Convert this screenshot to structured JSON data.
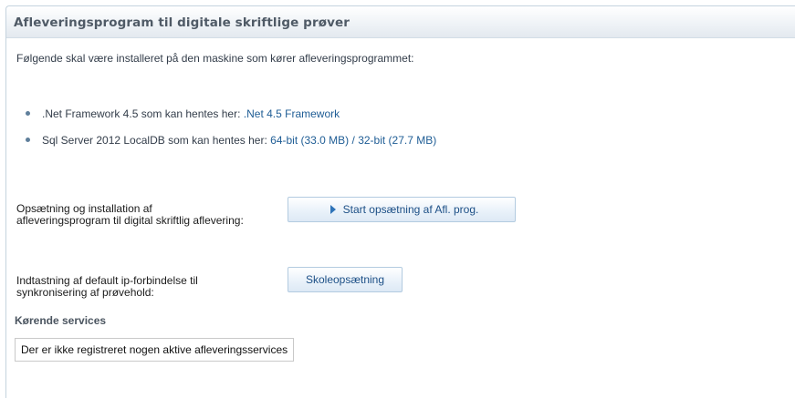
{
  "panel": {
    "title": "Afleveringsprogram til digitale skriftlige prøver"
  },
  "requirements": {
    "intro": "Følgende skal være installeret på den maskine som kører afleveringsprogrammet:",
    "items": [
      {
        "text": ".Net Framework 4.5 som kan hentes her: ",
        "link": ".Net 4.5 Framework"
      },
      {
        "text": "Sql Server 2012 LocalDB som kan hentes her: ",
        "link_64": "64-bit (33.0 MB)",
        "separator": " / ",
        "link_32": "32-bit (27.7 MB)"
      }
    ]
  },
  "setup": {
    "label": "Opsætning og installation af afleveringsprogram til digital skriftlig aflevering:",
    "button": "Start opsætning af Afl. prog.",
    "button_icon": "play-triangle-icon"
  },
  "school": {
    "label": "Indtastning af default ip-forbindelse til synkronisering af prøvehold:",
    "button": "Skoleopsætning"
  },
  "services": {
    "heading": "Kørende services",
    "message": "Der er ikke registreret nogen aktive afleveringsservices"
  },
  "colors": {
    "link": "#1f5d95",
    "button_text": "#1c4f86",
    "header_text": "#4f5a66",
    "bullet": "#5f7f9b"
  }
}
